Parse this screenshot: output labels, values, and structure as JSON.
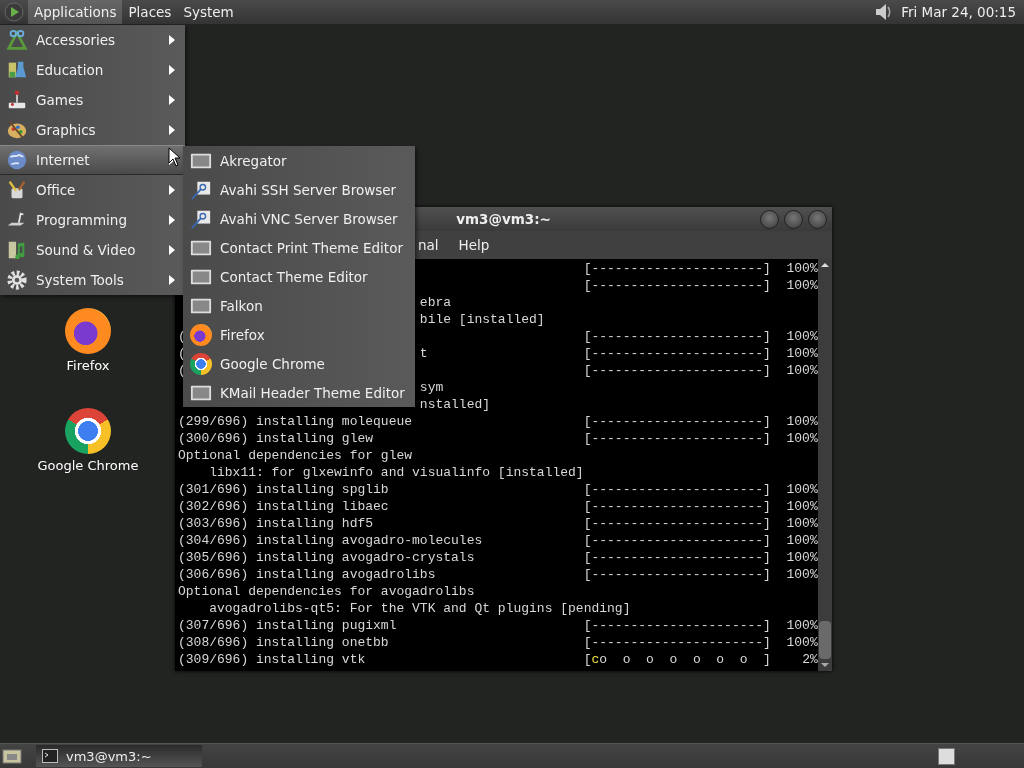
{
  "top_panel": {
    "menus": [
      {
        "label": "Applications",
        "selected": true
      },
      {
        "label": "Places",
        "selected": false
      },
      {
        "label": "System",
        "selected": false
      }
    ],
    "clock": "Fri Mar 24, 00:15"
  },
  "applications_menu": {
    "items": [
      {
        "label": "Accessories",
        "kind": "accessories",
        "selected": false
      },
      {
        "label": "Education",
        "kind": "education",
        "selected": false
      },
      {
        "label": "Games",
        "kind": "games",
        "selected": false
      },
      {
        "label": "Graphics",
        "kind": "graphics",
        "selected": false
      },
      {
        "label": "Internet",
        "kind": "internet",
        "selected": true
      },
      {
        "label": "Office",
        "kind": "office",
        "selected": false
      },
      {
        "label": "Programming",
        "kind": "programming",
        "selected": false
      },
      {
        "label": "Sound & Video",
        "kind": "media",
        "selected": false
      },
      {
        "label": "System Tools",
        "kind": "system",
        "selected": false
      }
    ]
  },
  "internet_submenu": {
    "items": [
      {
        "label": "Akregator",
        "kind": "generic"
      },
      {
        "label": "Avahi SSH Server Browser",
        "kind": "avahi"
      },
      {
        "label": "Avahi VNC Server Browser",
        "kind": "avahi"
      },
      {
        "label": "Contact Print Theme Editor",
        "kind": "generic"
      },
      {
        "label": "Contact Theme Editor",
        "kind": "generic"
      },
      {
        "label": "Falkon",
        "kind": "generic"
      },
      {
        "label": "Firefox",
        "kind": "firefox"
      },
      {
        "label": "Google Chrome",
        "kind": "chrome"
      },
      {
        "label": "KMail Header Theme Editor",
        "kind": "generic"
      }
    ]
  },
  "desktop_icons": [
    {
      "label": "Firefox",
      "kind": "firefox"
    },
    {
      "label": "Google Chrome",
      "kind": "chrome"
    }
  ],
  "terminal": {
    "title": "vm3@vm3:~",
    "menus": [
      "nal",
      "Help"
    ],
    "lines": [
      {
        "progress": {
          "kind": "bar",
          "bar": "[----------------------]",
          "percent": "100%"
        }
      },
      {
        "progress": {
          "kind": "bar",
          "bar": "[----------------------]",
          "percent": "100%"
        }
      },
      {
        "tail": "ebra"
      },
      {
        "tail": "bile [installed]"
      },
      {
        "lead": "(",
        "progress": {
          "kind": "bar",
          "bar": "[----------------------]",
          "percent": "100%"
        }
      },
      {
        "lead": "(",
        "tail": "t",
        "progress": {
          "kind": "bar",
          "bar": "[----------------------]",
          "percent": "100%"
        }
      },
      {
        "lead": "(",
        "progress": {
          "kind": "bar",
          "bar": "[----------------------]",
          "percent": "100%"
        }
      },
      {
        "tail": "sym"
      },
      {
        "tail": "nstalled]"
      },
      {
        "text": "(299/696) installing molequeue",
        "progress": {
          "kind": "bar",
          "bar": "[----------------------]",
          "percent": "100%"
        }
      },
      {
        "text": "(300/696) installing glew",
        "progress": {
          "kind": "bar",
          "bar": "[----------------------]",
          "percent": "100%"
        }
      },
      {
        "text": "Optional dependencies for glew"
      },
      {
        "text": "    libx11: for glxewinfo and visualinfo [installed]"
      },
      {
        "text": "(301/696) installing spglib",
        "progress": {
          "kind": "bar",
          "bar": "[----------------------]",
          "percent": "100%"
        }
      },
      {
        "text": "(302/696) installing libaec",
        "progress": {
          "kind": "bar",
          "bar": "[----------------------]",
          "percent": "100%"
        }
      },
      {
        "text": "(303/696) installing hdf5",
        "progress": {
          "kind": "bar",
          "bar": "[----------------------]",
          "percent": "100%"
        }
      },
      {
        "text": "(304/696) installing avogadro-molecules",
        "progress": {
          "kind": "bar",
          "bar": "[----------------------]",
          "percent": "100%"
        }
      },
      {
        "text": "(305/696) installing avogadro-crystals",
        "progress": {
          "kind": "bar",
          "bar": "[----------------------]",
          "percent": "100%"
        }
      },
      {
        "text": "(306/696) installing avogadrolibs",
        "progress": {
          "kind": "bar",
          "bar": "[----------------------]",
          "percent": "100%"
        }
      },
      {
        "text": "Optional dependencies for avogadrolibs"
      },
      {
        "text": "    avogadrolibs-qt5: For the VTK and Qt plugins [pending]"
      },
      {
        "text": "(307/696) installing pugixml",
        "progress": {
          "kind": "bar",
          "bar": "[----------------------]",
          "percent": "100%"
        }
      },
      {
        "text": "(308/696) installing onetbb",
        "progress": {
          "kind": "bar",
          "bar": "[----------------------]",
          "percent": "100%"
        }
      },
      {
        "text": "(309/696) installing vtk",
        "progress": {
          "kind": "pacman",
          "open": "[",
          "head": "c",
          "dots": "o  o  o  o  o  o  o  ]",
          "percent": "2%"
        }
      }
    ]
  },
  "bottom_panel": {
    "tasks": [
      {
        "label": "vm3@vm3:~",
        "selected": true
      }
    ]
  }
}
